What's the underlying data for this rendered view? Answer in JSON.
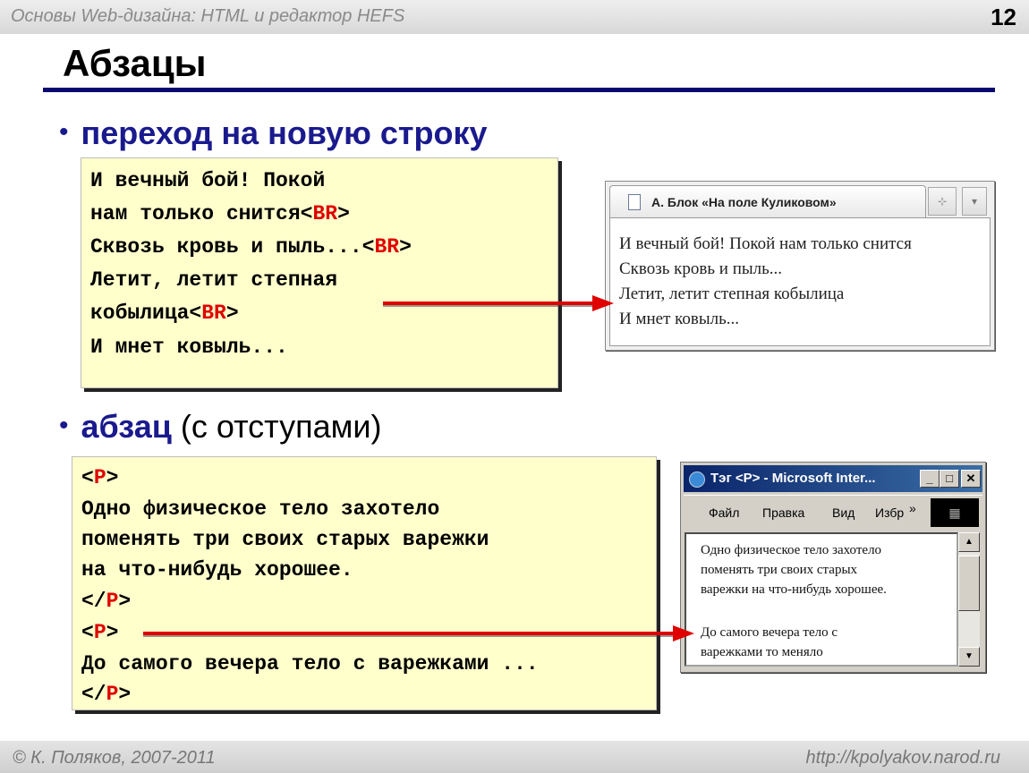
{
  "header": {
    "course": "Основы Web-дизайна: HTML и редактор HEFS",
    "page_number": "12"
  },
  "title": "Абзацы",
  "section1": {
    "bullet": "•",
    "heading": "переход на новую строку",
    "code": {
      "l1": "И вечный бой! Покой",
      "l2_text": "нам только снится",
      "l2_tag_open": "<",
      "l2_tag": "BR",
      "l2_tag_close": ">",
      "l3_text": "Сквозь кровь и пыль...",
      "l3_tag_open": "<",
      "l3_tag": "BR",
      "l3_tag_close": ">",
      "l4": "Летит, летит степная",
      "l5_text": "кобылица",
      "l5_tag_open": "<",
      "l5_tag": "BR",
      "l5_tag_close": ">",
      "l6": "И мнет ковыль..."
    },
    "browser": {
      "tab_title": "А. Блок «На поле Куликовом»",
      "btn_new_tab": "⊹",
      "btn_menu": "▾",
      "lines": [
        "И вечный бой! Покой нам только снится",
        "Сквозь кровь и пыль...",
        "Летит, летит степная кобылица",
        "И мнет ковыль..."
      ]
    }
  },
  "section2": {
    "bullet": "•",
    "heading_bold": "абзац",
    "heading_rest": " (с отступами)",
    "code": {
      "l1_open": "<",
      "l1_tag": "P",
      "l1_close": ">",
      "l2": "Одно физическое тело захотело",
      "l3": "поменять три своих старых варежки",
      "l4": "на что-нибудь хорошее.",
      "l5_open": "</",
      "l5_tag": "P",
      "l5_close": ">",
      "l6_open": "<",
      "l6_tag": "P",
      "l6_close": ">",
      "l7": "До самого вечера тело с варежками ...",
      "l8_open": "</",
      "l8_tag": "P",
      "l8_close": ">"
    },
    "browser": {
      "window_title": "Тэг <P> - Microsoft Inter...",
      "btn_min": "_",
      "btn_max": "□",
      "btn_close": "✕",
      "menu": [
        "Файл",
        "Правка",
        "Вид",
        "Избр"
      ],
      "menu_more": "»",
      "lines": [
        "Одно физическое тело захотело",
        "поменять три своих старых",
        "варежки на что-нибудь хорошее.",
        "До самого вечера тело с",
        "варежками то меняло"
      ],
      "scroll_up": "▲",
      "scroll_down": "▼"
    }
  },
  "footer": {
    "author": "© К. Поляков, 2007-2011",
    "url": "http://kpolyakov.narod.ru"
  },
  "colors": {
    "accent": "#1a1a8e",
    "tag": "#e00000",
    "code_bg": "#ffffcc",
    "rule": "#0a0a6e",
    "arrow": "#e00000"
  }
}
